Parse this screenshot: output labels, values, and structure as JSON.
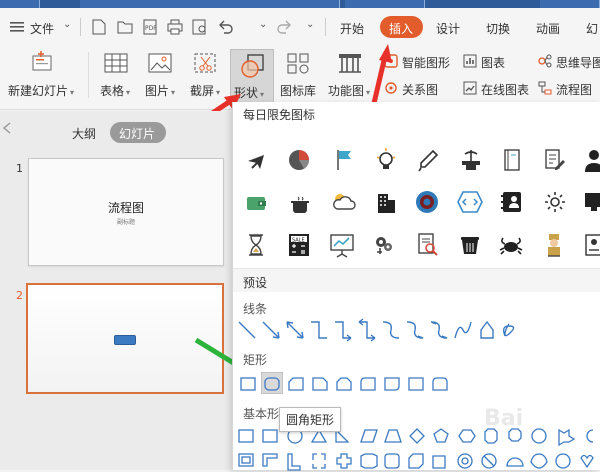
{
  "menu": {
    "file_label": "文件",
    "tabs": [
      "开始",
      "插入",
      "设计",
      "切换",
      "动画",
      "幻"
    ],
    "active_tab": "插入",
    "active_color": "#e25c2c"
  },
  "ribbon": {
    "new_slide": "新建幻灯片",
    "table": "表格",
    "picture": "图片",
    "screenshot": "截屏",
    "shapes": "形状",
    "icon_lib": "图标库",
    "func_chart": "功能图",
    "smart_graphic": "智能图形",
    "chart": "图表",
    "mind_map": "思维导图",
    "relation_map": "关系图",
    "online_chart": "在线图表",
    "flowchart": "流程图"
  },
  "left_panel": {
    "tab_outline": "大纲",
    "tab_slides": "幻灯片",
    "slides": [
      {
        "number": "1",
        "title": "流程图",
        "subtitle": "副标题"
      },
      {
        "number": "2"
      }
    ]
  },
  "dropdown": {
    "daily_icons_title": "每日限免图标",
    "presets_title": "预设",
    "cat_lines": "线条",
    "cat_rects": "矩形",
    "cat_basic": "基本形状",
    "tooltip": "圆角矩形"
  },
  "colors": {
    "accent": "#e25c2c",
    "slide_selected_border": "#d9713a",
    "shape_blue": "#3c7ac2",
    "arrow_red": "#e8312a",
    "arrow_green": "#2bb33a"
  }
}
